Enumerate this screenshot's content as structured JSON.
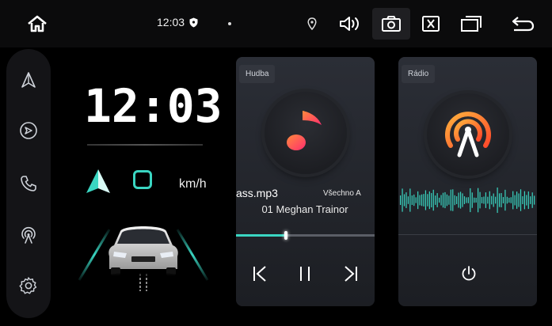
{
  "statusbar": {
    "time": "12:03",
    "icons": [
      "home-icon",
      "shield-icon",
      "location-pin-icon",
      "volume-icon",
      "screenshot-icon",
      "close-app-icon",
      "recent-apps-icon",
      "back-icon"
    ]
  },
  "sidebar": {
    "items": [
      "navigation-icon",
      "carplay-icon",
      "phone-icon",
      "radio-signal-icon",
      "settings-icon"
    ]
  },
  "dashboard": {
    "clock": "12:03",
    "speed_unit": "km/h"
  },
  "music_card": {
    "tag": "Hudba",
    "track": "ass.mp3",
    "album": "Všechno A",
    "artist": "01 Meghan Trainor",
    "progress": 0.36
  },
  "radio_card": {
    "tag": "Rádio"
  },
  "colors": {
    "accent": "#3ad6c2",
    "music_gradient_start": "#ff2d6f",
    "music_gradient_end": "#ff8a3d",
    "radio_gradient_start": "#ff5a2b",
    "radio_gradient_end": "#ffb13d",
    "wave": "#3ad6c2"
  }
}
